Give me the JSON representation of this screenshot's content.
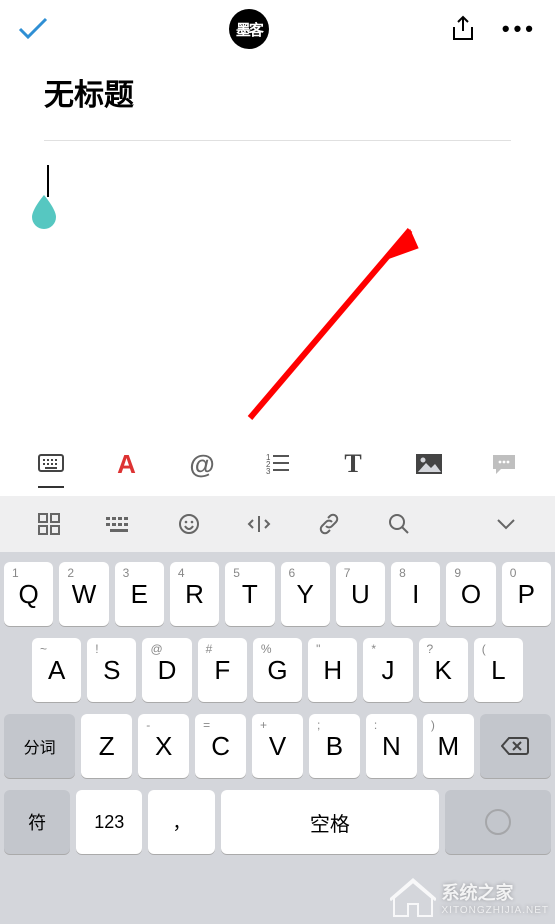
{
  "header": {
    "logo_text": "墨客",
    "more_label": "•••"
  },
  "editor": {
    "title": "无标题"
  },
  "format_toolbar": {
    "font": "A",
    "mention": "@",
    "heading": "T"
  },
  "keyboard": {
    "row1": [
      {
        "sup": "1",
        "main": "Q"
      },
      {
        "sup": "2",
        "main": "W"
      },
      {
        "sup": "3",
        "main": "E"
      },
      {
        "sup": "4",
        "main": "R"
      },
      {
        "sup": "5",
        "main": "T"
      },
      {
        "sup": "6",
        "main": "Y"
      },
      {
        "sup": "7",
        "main": "U"
      },
      {
        "sup": "8",
        "main": "I"
      },
      {
        "sup": "9",
        "main": "O"
      },
      {
        "sup": "0",
        "main": "P"
      }
    ],
    "row2": [
      {
        "sup": "~",
        "main": "A"
      },
      {
        "sup": "!",
        "main": "S"
      },
      {
        "sup": "@",
        "main": "D"
      },
      {
        "sup": "#",
        "main": "F"
      },
      {
        "sup": "%",
        "main": "G"
      },
      {
        "sup": "\"",
        "main": "H"
      },
      {
        "sup": "*",
        "main": "J"
      },
      {
        "sup": "?",
        "main": "K"
      },
      {
        "sup": "(",
        "main": "L"
      }
    ],
    "row3": {
      "shift_label": "分词",
      "keys": [
        {
          "sup": "",
          "main": "Z"
        },
        {
          "sup": "-",
          "main": "X"
        },
        {
          "sup": "=",
          "main": "C"
        },
        {
          "sup": "+",
          "main": "V"
        },
        {
          "sup": ";",
          "main": "B"
        },
        {
          "sup": ":",
          "main": "N"
        },
        {
          "sup": ")",
          "main": "M"
        }
      ]
    },
    "row4": {
      "sym": "符",
      "num": "123",
      "comma": "，",
      "space": "空格"
    }
  },
  "watermark": {
    "name": "系统之家",
    "url": "XITONGZHIJIA.NET"
  }
}
